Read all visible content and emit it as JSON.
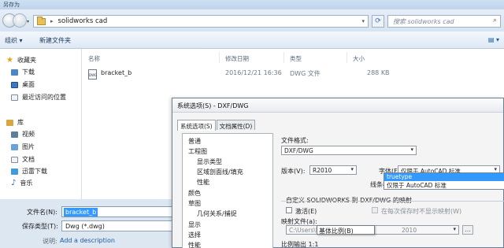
{
  "save_dialog": {
    "window_title": "另存为",
    "address": {
      "crumb": "solidworks cad"
    },
    "search_placeholder": "搜索 solidworks cad",
    "toolbar": {
      "organize": "组织 ▾",
      "new_folder": "新建文件夹"
    },
    "nav": {
      "favorites": "收藏夹",
      "download": "下载",
      "desktop": "桌面",
      "recent": "最近访问的位置",
      "libraries": "库",
      "videos": "视频",
      "pictures": "图片",
      "documents": "文档",
      "thunder": "迅雷下载",
      "music": "音乐"
    },
    "columns": {
      "name": "名称",
      "modified": "修改日期",
      "type": "类型",
      "size": "大小"
    },
    "files": [
      {
        "name": "bracket_b",
        "modified": "2016/12/21 16:36",
        "type": "DWG 文件",
        "size": "288 KB"
      }
    ],
    "filename_label": "文件名(N):",
    "filename_value": "bracket_b",
    "filetype_label": "保存类型(T):",
    "filetype_value": "Dwg (*.dwg)",
    "desc_label": "说明:",
    "desc_link": "Add a description"
  },
  "options_dialog": {
    "title": "系统选项(S) - DXF/DWG",
    "tabs": [
      "系统选项(S)",
      "文档属性(D)"
    ],
    "tree": [
      "普通",
      "工程图",
      "显示类型",
      "区域剖面线/填充",
      "性能",
      "颜色",
      "草图",
      "几何关系/捕捉",
      "显示",
      "选择",
      "性能"
    ],
    "format_label": "文件格式:",
    "format_value": "DXF/DWG",
    "version_label": "版本(V):",
    "version_value": "R2010",
    "font_label": "字体(F):",
    "font_value": "仅限于 AutoCAD 标准",
    "linestyle_label": "线条样式(L):",
    "font_options": [
      "truetype",
      "仅限于 AutoCAD 标准"
    ],
    "mapping_heading": "自定义 SOLIDWORKS 到 DXF/DWG 的映射",
    "enable_label": "激活(E)",
    "nomap_label": "在每次保存时不显示映射(W)",
    "mapfile_label": "映射文件(a):",
    "mapfile_value": "C:\\Users\\ls\\Desktop\\solid",
    "mapfile_tail": "2010",
    "scale_heading": "比例输出 1:1",
    "tooltip": "基体比例(B)"
  },
  "colors": {
    "selection": "#3399ff",
    "link": "#1e5aa0"
  }
}
